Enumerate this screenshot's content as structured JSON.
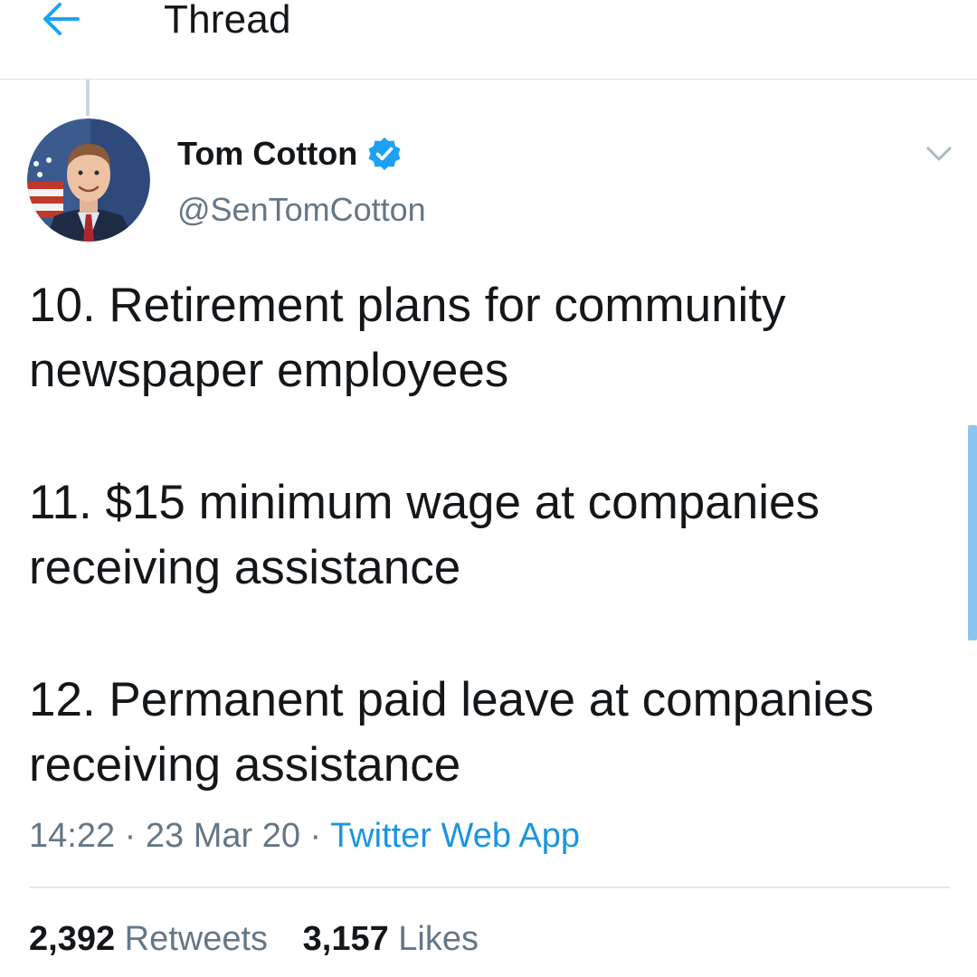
{
  "header": {
    "title": "Thread",
    "back_icon": "arrow-left-icon",
    "accent": "#1da1f2"
  },
  "tweet": {
    "author_name": "Tom Cotton",
    "handle": "@SenTomCotton",
    "verified": true,
    "paragraphs": [
      "10. Retirement plans for community newspaper employees",
      "11. $15 minimum wage at companies receiving assistance",
      "12. Permanent paid leave at companies receiving assistance"
    ],
    "time": "14:22",
    "separator": "·",
    "date": "23 Mar 20",
    "source": "Twitter Web App",
    "retweets_count": "2,392",
    "retweets_label": "Retweets",
    "likes_count": "3,157",
    "likes_label": "Likes"
  },
  "colors": {
    "text": "#14171a",
    "secondary": "#657786",
    "link": "#1b95e0",
    "divider": "#e1e8ed"
  }
}
